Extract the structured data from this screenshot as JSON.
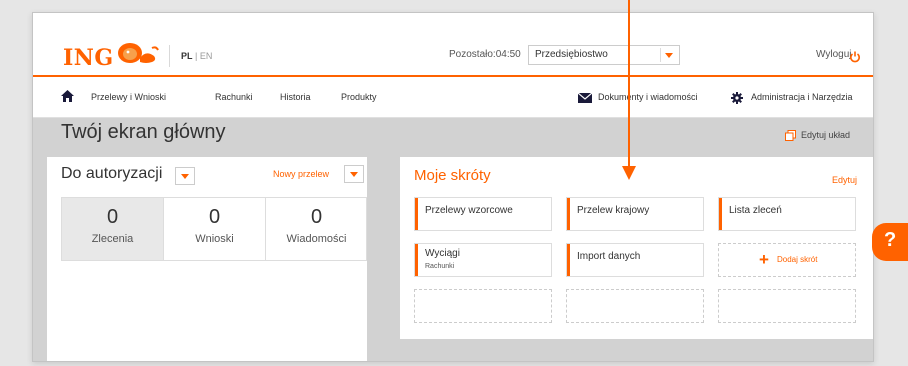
{
  "brand": {
    "logo_text": "ING"
  },
  "header": {
    "lang_active": "PL",
    "lang_sep": " | ",
    "lang_other": "EN",
    "remaining": "Pozostało:04:50",
    "account_select": "Przedsiębiostwo",
    "logout": "Wyloguj"
  },
  "nav": {
    "items": [
      "Przelewy i Wnioski",
      "Rachunki",
      "Historia",
      "Produkty"
    ],
    "docs": "Dokumenty i wiadomości",
    "admin": "Administracja i Narzędzia"
  },
  "page": {
    "title": "Twój ekran główny",
    "edit_layout": "Edytuj układ"
  },
  "authorization": {
    "title": "Do autoryzacji",
    "new_transfer": "Nowy przelew",
    "stats": [
      {
        "value": "0",
        "label": "Zlecenia"
      },
      {
        "value": "0",
        "label": "Wnioski"
      },
      {
        "value": "0",
        "label": "Wiadomości"
      }
    ]
  },
  "shortcuts": {
    "title": "Moje skróty",
    "edit": "Edytuj",
    "tiles": [
      {
        "title": "Przelewy wzorcowe",
        "subtitle": ""
      },
      {
        "title": "Przelew krajowy",
        "subtitle": ""
      },
      {
        "title": "Lista zleceń",
        "subtitle": ""
      },
      {
        "title": "Wyciągi",
        "subtitle": "Rachunki"
      },
      {
        "title": "Import danych",
        "subtitle": ""
      }
    ],
    "add_label": "Dodaj skrót"
  },
  "help": {
    "label": "?"
  },
  "colors": {
    "accent": "#ff6200",
    "panel_bg": "#d2d2d2"
  }
}
